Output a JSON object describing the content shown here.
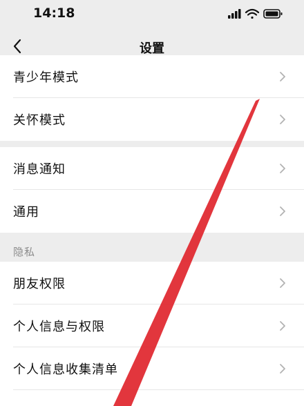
{
  "status_bar": {
    "time": "14:18"
  },
  "nav": {
    "title": "设置"
  },
  "groups": [
    {
      "items": [
        "青少年模式",
        "关怀模式"
      ]
    },
    {
      "items": [
        "消息通知",
        "通用"
      ]
    },
    {
      "header": "隐私",
      "items": [
        "朋友权限",
        "个人信息与权限",
        "个人信息收集清单"
      ]
    }
  ],
  "colors": {
    "background": "#ededed",
    "row": "#ffffff",
    "chevron": "#b2b2b2",
    "annotation_arrow": "#e0252c"
  }
}
